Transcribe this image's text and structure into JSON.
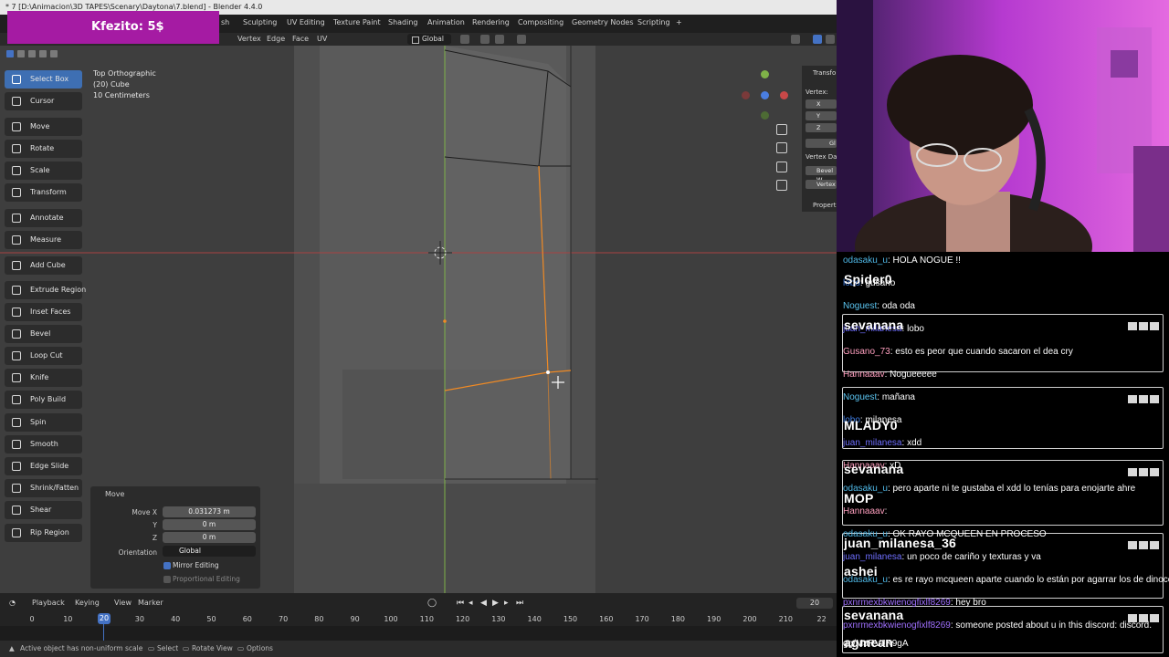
{
  "window": {
    "title": "* 7 [D:\\Animacion\\3D TAPES\\Scenary\\Daytona\\7.blend] - Blender 4.4.0"
  },
  "donation": {
    "text": "Kfezito: 5$"
  },
  "workspace_tabs": [
    "sh",
    "Sculpting",
    "UV Editing",
    "Texture Paint",
    "Shading",
    "Animation",
    "Rendering",
    "Compositing",
    "Geometry Nodes",
    "Scripting",
    "+"
  ],
  "header_menu": [
    "Vertex",
    "Edge",
    "Face",
    "UV"
  ],
  "transform_orientation": "Global",
  "viewport": {
    "view_name": "Top Orthographic",
    "object": "(20) Cube",
    "scale": "10 Centimeters"
  },
  "tools": [
    {
      "label": "Select Box",
      "icon": "select-box-icon",
      "active": true
    },
    {
      "label": "Cursor",
      "icon": "cursor-icon"
    },
    {
      "label": "Move",
      "icon": "move-icon"
    },
    {
      "label": "Rotate",
      "icon": "rotate-icon"
    },
    {
      "label": "Scale",
      "icon": "scale-icon"
    },
    {
      "label": "Transform",
      "icon": "transform-icon"
    },
    {
      "label": "Annotate",
      "icon": "annotate-icon"
    },
    {
      "label": "Measure",
      "icon": "measure-icon"
    },
    {
      "label": "Add Cube",
      "icon": "add-cube-icon"
    },
    {
      "label": "Extrude Region",
      "icon": "extrude-icon"
    },
    {
      "label": "Inset Faces",
      "icon": "inset-icon"
    },
    {
      "label": "Bevel",
      "icon": "bevel-icon"
    },
    {
      "label": "Loop Cut",
      "icon": "loop-cut-icon"
    },
    {
      "label": "Knife",
      "icon": "knife-icon"
    },
    {
      "label": "Poly Build",
      "icon": "poly-build-icon"
    },
    {
      "label": "Spin",
      "icon": "spin-icon"
    },
    {
      "label": "Smooth",
      "icon": "smooth-icon"
    },
    {
      "label": "Edge Slide",
      "icon": "edge-slide-icon"
    },
    {
      "label": "Shrink/Fatten",
      "icon": "shrink-fatten-icon"
    },
    {
      "label": "Shear",
      "icon": "shear-icon"
    },
    {
      "label": "Rip Region",
      "icon": "rip-icon"
    }
  ],
  "npanel": {
    "tab": "Transfo",
    "vertex_label": "Vertex:",
    "axes": [
      "X",
      "Y",
      "Z"
    ],
    "global_btn": "Gl",
    "vertex_data": "Vertex Da",
    "bevel_w": "Bevel W",
    "vertex_c": "Vertex",
    "properties": "Propert"
  },
  "operator_panel": {
    "title": "Move",
    "move_x_label": "Move X",
    "move_x": "0.031273 m",
    "y_label": "Y",
    "y": "0 m",
    "z_label": "Z",
    "z": "0 m",
    "orientation_label": "Orientation",
    "orientation": "Global",
    "mirror_editing": "Mirror Editing",
    "proportional_editing": "Proportional Editing"
  },
  "timeline": {
    "menus": [
      "Playback",
      "Keying",
      "View",
      "Marker"
    ],
    "current_frame": "20",
    "end_frame": "20",
    "ticks": [
      "0",
      "10",
      "20",
      "30",
      "40",
      "50",
      "60",
      "70",
      "80",
      "90",
      "100",
      "110",
      "120",
      "130",
      "140",
      "150",
      "160",
      "170",
      "180",
      "190",
      "200",
      "210",
      "22"
    ]
  },
  "statusbar": {
    "warning": "Active object has non-uniform scale",
    "select": "Select",
    "rotate_view": "Rotate View",
    "options": "Options"
  },
  "chat": {
    "lines": [
      {
        "user": "odasaku_u",
        "msg": "HOLA NOGUE !!",
        "color": "#4fb8e6"
      },
      {
        "user": "lobo",
        "msg": "gusano",
        "color": "#3f7ce0"
      },
      {
        "user": "Noguest",
        "msg": "oda oda",
        "color": "#5bc4f0"
      },
      {
        "user": "juan_milanesa",
        "msg": "lobo",
        "color": "#6f6fff"
      },
      {
        "user": "Gusano_73",
        "msg": "esto es peor que cuando sacaron el dea cry",
        "color": "#ff9fbf"
      },
      {
        "user": "Hannaaav",
        "msg": "Nogueeeee",
        "color": "#ff9fbf"
      },
      {
        "user": "Noguest",
        "msg": "mañana",
        "color": "#5bc4f0"
      },
      {
        "user": "lobo",
        "msg": "milanesa",
        "color": "#3f7ce0"
      },
      {
        "user": "juan_milanesa",
        "msg": "xdd",
        "color": "#6f6fff"
      },
      {
        "user": "Hannaaav",
        "msg": "xD",
        "color": "#ff9fbf"
      },
      {
        "user": "odasaku_u",
        "msg": "pero aparte ni te gustaba el xdd lo tenías para enojarte ahre",
        "color": "#4fb8e6"
      },
      {
        "user": "Hannaaav",
        "msg": "",
        "color": "#ff9fbf"
      },
      {
        "user": "odasaku_u",
        "msg": "OK RAYO MCQUEEN EN PROCESO",
        "color": "#4fb8e6"
      },
      {
        "user": "juan_milanesa",
        "msg": "un poco de cariño y texturas y va",
        "color": "#6f6fff"
      },
      {
        "user": "odasaku_u",
        "msg": "es re rayo mcqueen aparte cuando lo están por agarrar los de dinoco",
        "color": "#4fb8e6"
      },
      {
        "user": "pxnrmexbkwienogfixlf8269",
        "msg": "hey bro",
        "color": "#a070ff"
      },
      {
        "user": "pxnrmexbkwienogfixlf8269",
        "msg": "someone posted about u in this discord: discord.",
        "color": "#a070ff"
      },
      {
        "user": "gg/MaRVJR9gA",
        "msg": "",
        "color": "#ffffff"
      }
    ],
    "overlay_names": [
      "Spider0",
      "sevanana",
      "MLADY0",
      "sevanana",
      "MOP",
      "juan_milanesa_36",
      "ashei",
      "sevanana",
      "agmean"
    ]
  },
  "colors": {
    "accent": "#4472c4",
    "donation_bg": "#a51ba3",
    "selection_orange": "#f08a24",
    "axis_red": "#c84848",
    "axis_green": "#7fb248"
  }
}
